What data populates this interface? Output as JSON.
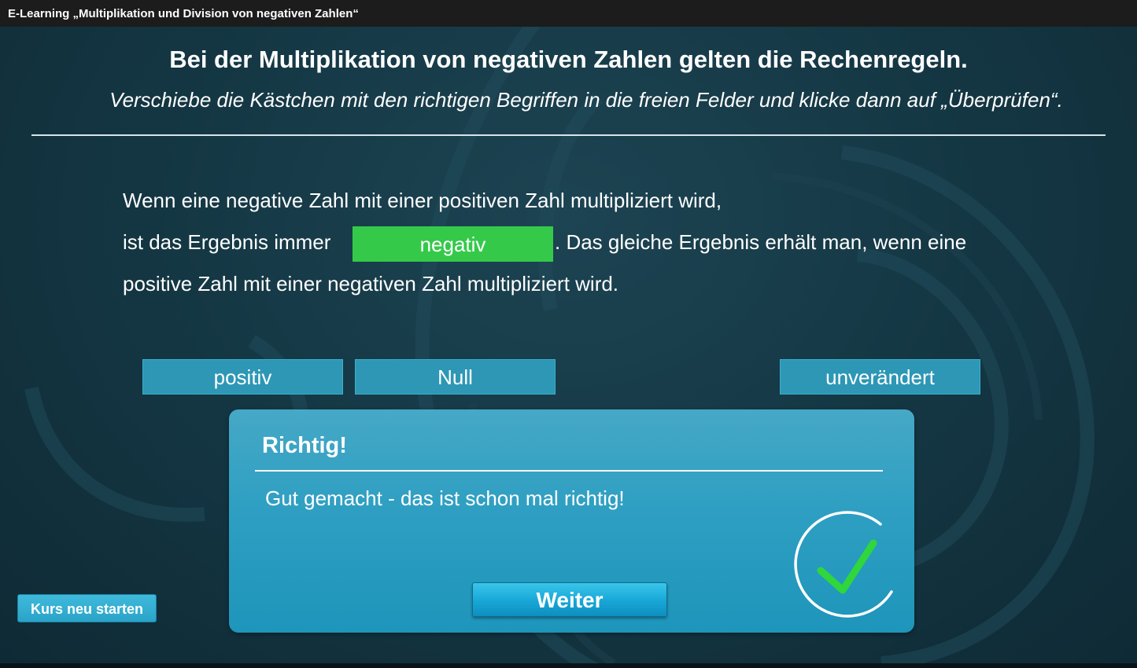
{
  "window": {
    "title": "E-Learning „Multiplikation und Division von negativen Zahlen“"
  },
  "task": {
    "heading": "Bei der Multiplikation von negativen Zahlen gelten die Rechenregeln.",
    "instruction": "Verschiebe die Kästchen mit den richtigen Begriffen in die freien Felder und klicke dann auf „Überprüfen“."
  },
  "sentence": {
    "line1": "Wenn eine negative Zahl mit einer positiven Zahl multipliziert wird,",
    "line2_before": "ist das Ergebnis immer",
    "filled_slot": "negativ",
    "line2_after": ". Das gleiche Ergebnis erhält man, wenn eine",
    "line3": "positive Zahl mit einer negativen Zahl multipliziert wird."
  },
  "options": [
    "positiv",
    "Null",
    "unverändert"
  ],
  "feedback": {
    "title": "Richtig!",
    "message": "Gut gemacht - das ist schon mal richtig!",
    "button_label": "Weiter",
    "icon": "checkmark-circle-icon",
    "check_color": "#2fd63c"
  },
  "footer": {
    "restart_label": "Kurs neu starten"
  },
  "colors": {
    "background": "#153845",
    "drop_slot": "#35c94a",
    "chip": "#2d97b5",
    "dialog": "#2e9fc2",
    "accent_button": "#18a6d6"
  }
}
